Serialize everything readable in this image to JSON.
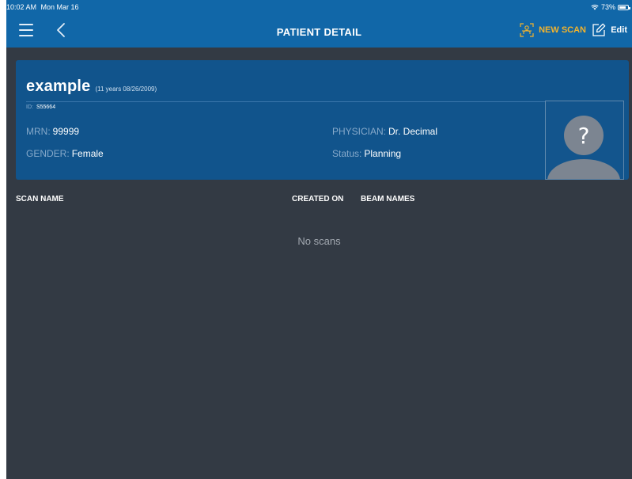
{
  "status_bar": {
    "time": "10:02 AM",
    "date": "Mon Mar 16",
    "battery": "73%",
    "icons": [
      "wifi-icon",
      "battery-icon"
    ]
  },
  "nav": {
    "title": "PATIENT DETAIL",
    "new_scan_label": "NEW SCAN",
    "edit_label": "Edit",
    "icons": [
      "menu-icon",
      "back-chevron-icon",
      "scan-icon",
      "edit-icon"
    ]
  },
  "patient": {
    "name": "example",
    "age_dob": "(11 years 08/26/2009)",
    "id_label": "ID:",
    "id_value": "S55664",
    "mrn_label": "MRN:",
    "mrn_value": "99999",
    "gender_label": "GENDER:",
    "gender_value": "Female",
    "physician_label": "PHYSICIAN:",
    "physician_value": "Dr. Decimal",
    "status_label": "Status:",
    "status_value": "Planning",
    "avatar_glyph": "?"
  },
  "table": {
    "columns": [
      "SCAN NAME",
      "CREATED ON",
      "BEAM NAMES"
    ],
    "empty_message": "No scans"
  },
  "colors": {
    "nav_bar": "#1167a8",
    "background": "#333a44",
    "card": "#11548c",
    "accent": "#f2b32d"
  }
}
